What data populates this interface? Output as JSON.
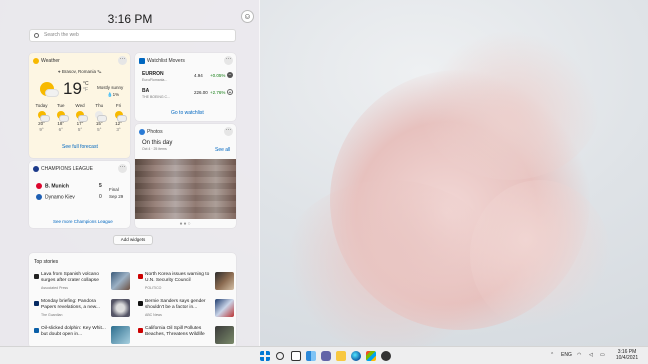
{
  "panel": {
    "time": "3:16 PM",
    "search_placeholder": "Search the web",
    "add_widgets": "Add widgets"
  },
  "weather": {
    "title": "Weather",
    "location": "Brasov, Romania",
    "temp": "19",
    "unit": "°C",
    "unit_alt": "°F",
    "condition": "Mostly sunny",
    "precip": "1%",
    "days": [
      {
        "name": "Today",
        "hi": "20°",
        "lo": "9°",
        "icon": "sun-cloud-icon"
      },
      {
        "name": "Tue",
        "hi": "18°",
        "lo": "6°",
        "icon": "sun-cloud-icon"
      },
      {
        "name": "Wed",
        "hi": "17°",
        "lo": "5°",
        "icon": "sun-cloud-icon"
      },
      {
        "name": "Thu",
        "hi": "15°",
        "lo": "5°",
        "icon": "cloud-icon"
      },
      {
        "name": "Fri",
        "hi": "12°",
        "lo": "3°",
        "icon": "sun-cloud-icon"
      }
    ],
    "footer": "See full forecast"
  },
  "watchlist": {
    "title": "Watchlist Movers",
    "stocks": [
      {
        "symbol": "EURRON",
        "name": "Euro/Romania...",
        "price": "4.94",
        "change": "+0.05%"
      },
      {
        "symbol": "BA",
        "name": "THE BOEING C...",
        "price": "226.00",
        "change": "+2.76%"
      }
    ],
    "footer": "Go to watchlist"
  },
  "photos": {
    "title": "Photos",
    "heading": "On this day",
    "sub": "Oct 4 · 25 items",
    "see_all": "See all"
  },
  "league": {
    "title": "CHAMPIONS LEAGUE",
    "home": "B. Munich",
    "away": "Dynamo Kiev",
    "home_score": "5",
    "away_score": "0",
    "status": "Final",
    "date": "Sep 29",
    "footer": "See more Champions League"
  },
  "stories": {
    "title": "Top stories",
    "items": [
      {
        "title": "Lava from Spanish volcano surges after crater collapse",
        "source": "Associated Press"
      },
      {
        "title": "North Korea issues warning to U.N. Security Council",
        "source": "POLITICO"
      },
      {
        "title": "Monday briefing: Pandora Papers revelations, a new...",
        "source": "The Guardian"
      },
      {
        "title": "Bernie Sanders says gender shouldn't be a factor in...",
        "source": "ABC News"
      },
      {
        "title": "Oil-slicked dolphin: Key Whit... but doubt open in...",
        "source": ""
      },
      {
        "title": "California Oil Spill Pollutes Beaches, Threatens Wildlife",
        "source": ""
      }
    ]
  },
  "taskbar": {
    "lang": "ENG",
    "time": "3:16 PM",
    "date": "10/4/2021"
  },
  "colors": {
    "weather_bg": "#fdf6e3",
    "positive": "#107c10",
    "link": "#0067c0"
  }
}
